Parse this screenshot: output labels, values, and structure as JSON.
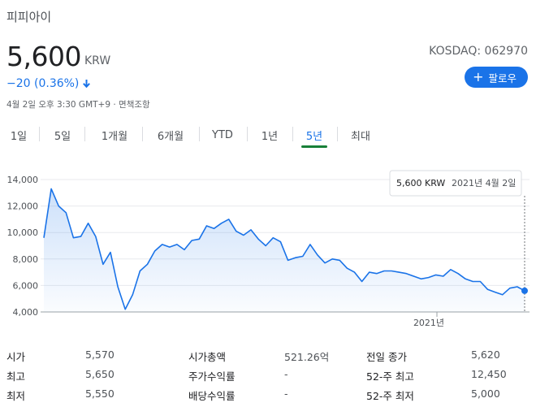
{
  "header": {
    "company": "피피아이",
    "price": "5,600",
    "currency": "KRW",
    "change": "−20 (0.36%)",
    "timestamp": "4월 2일 오후 3:30 GMT+9 · 면책조항",
    "ticker": "KOSDAQ: 062970",
    "follow_label": "팔로우",
    "change_color": "#1a73e8",
    "accent_color": "#1a73e8"
  },
  "tabs": [
    {
      "label": "1일",
      "active": false
    },
    {
      "label": "5일",
      "active": false
    },
    {
      "label": "1개월",
      "active": false
    },
    {
      "label": "6개월",
      "active": false
    },
    {
      "label": "YTD",
      "active": false
    },
    {
      "label": "1년",
      "active": false
    },
    {
      "label": "5년",
      "active": true
    },
    {
      "label": "최대",
      "active": false
    }
  ],
  "chart_data": {
    "type": "area",
    "y_ticks": [
      "14,000",
      "12,000",
      "10,000",
      "8,000",
      "6,000",
      "4,000"
    ],
    "ylim": [
      4000,
      14000
    ],
    "x_tick": "2021년",
    "tooltip_price": "5,600 KRW",
    "tooltip_date": "2021년 4월 2일",
    "line_color": "#1a73e8",
    "values": [
      9600,
      13300,
      12000,
      11500,
      9600,
      9700,
      10700,
      9700,
      7600,
      8500,
      5900,
      4200,
      5300,
      7100,
      7600,
      8600,
      9100,
      8900,
      9100,
      8700,
      9400,
      9500,
      10500,
      10300,
      10700,
      11000,
      10100,
      9800,
      10200,
      9500,
      9000,
      9600,
      9300,
      7900,
      8100,
      8200,
      9100,
      8300,
      7700,
      8000,
      7900,
      7300,
      7000,
      6300,
      7000,
      6900,
      7100,
      7100,
      7000,
      6900,
      6700,
      6500,
      6600,
      6800,
      6700,
      7200,
      6900,
      6500,
      6300,
      6300,
      5700,
      5500,
      5300,
      5800,
      5900,
      5600
    ]
  },
  "stats": [
    {
      "label": "시가",
      "value": "5,570"
    },
    {
      "label": "최고",
      "value": "5,650"
    },
    {
      "label": "최저",
      "value": "5,550"
    },
    {
      "label": "시가총액",
      "value": "521.26억"
    },
    {
      "label": "주가수익률",
      "value": "-"
    },
    {
      "label": "배당수익률",
      "value": "-"
    },
    {
      "label": "전일 종가",
      "value": "5,620"
    },
    {
      "label": "52-주 최고",
      "value": "12,450"
    },
    {
      "label": "52-주 최저",
      "value": "5,000"
    }
  ]
}
